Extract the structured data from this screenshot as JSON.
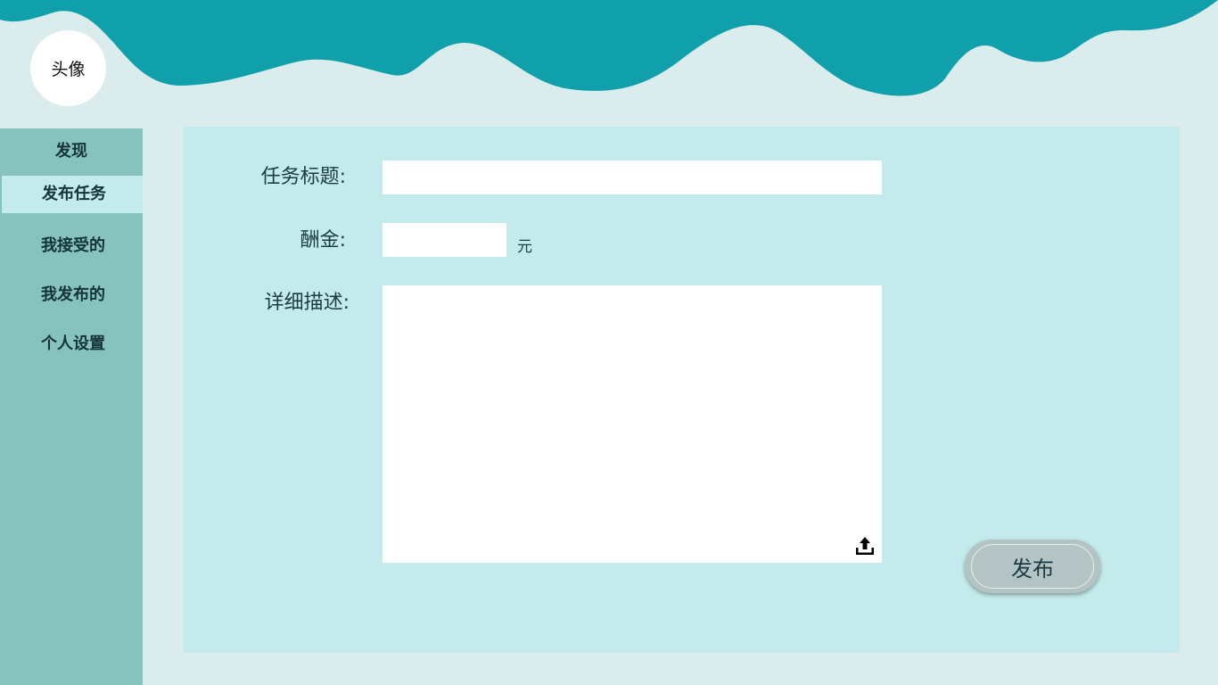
{
  "header": {
    "avatar_label": "头像"
  },
  "sidebar": {
    "items": [
      {
        "label": "发现"
      },
      {
        "label": "发布任务"
      },
      {
        "label": "我接受的"
      },
      {
        "label": "我发布的"
      },
      {
        "label": "个人设置"
      }
    ],
    "active_index": 1
  },
  "form": {
    "title_label": "任务标题:",
    "title_value": "",
    "reward_label": "酬金:",
    "reward_value": "",
    "reward_unit": "元",
    "desc_label": "详细描述:",
    "desc_value": "",
    "upload_icon": "upload-icon",
    "publish_label": "发布"
  },
  "colors": {
    "wave": "#10a0ab",
    "page_bg": "#dbeced",
    "sidebar_bg": "#86c3bd",
    "panel_bg": "#c3ebec",
    "button_bg": "#b4c3c3"
  }
}
